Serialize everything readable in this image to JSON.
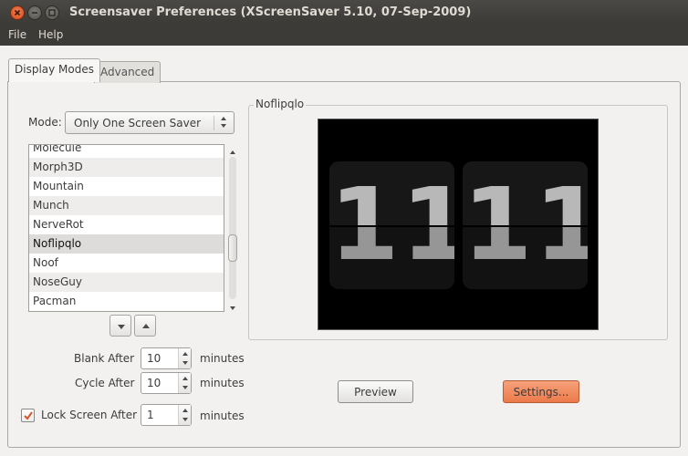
{
  "window": {
    "title": "Screensaver Preferences  (XScreenSaver 5.10, 07-Sep-2009)"
  },
  "menu": {
    "file": "File",
    "help": "Help"
  },
  "tabs": [
    {
      "label": "Display Modes",
      "active": true
    },
    {
      "label": "Advanced",
      "active": false
    }
  ],
  "mode": {
    "label": "Mode:",
    "value": "Only One Screen Saver"
  },
  "saver_list": {
    "items": [
      "Molecule",
      "Morph3D",
      "Mountain",
      "Munch",
      "NerveRot",
      "Noflipqlo",
      "Noof",
      "NoseGuy",
      "Pacman"
    ],
    "selected": "Noflipqlo"
  },
  "timing": {
    "blank_label": "Blank After",
    "blank_value": "10",
    "cycle_label": "Cycle After",
    "cycle_value": "10",
    "lock_label": "Lock Screen After",
    "lock_value": "1",
    "lock_checked": true,
    "unit": "minutes"
  },
  "preview": {
    "frame_title": "Noflipqlo",
    "hours": "11",
    "minutes": "11"
  },
  "buttons": {
    "preview": "Preview",
    "settings": "Settings..."
  },
  "colors": {
    "accent": "#ec7a4b",
    "titlebar": "#3c3b37",
    "close": "#e0552a"
  }
}
